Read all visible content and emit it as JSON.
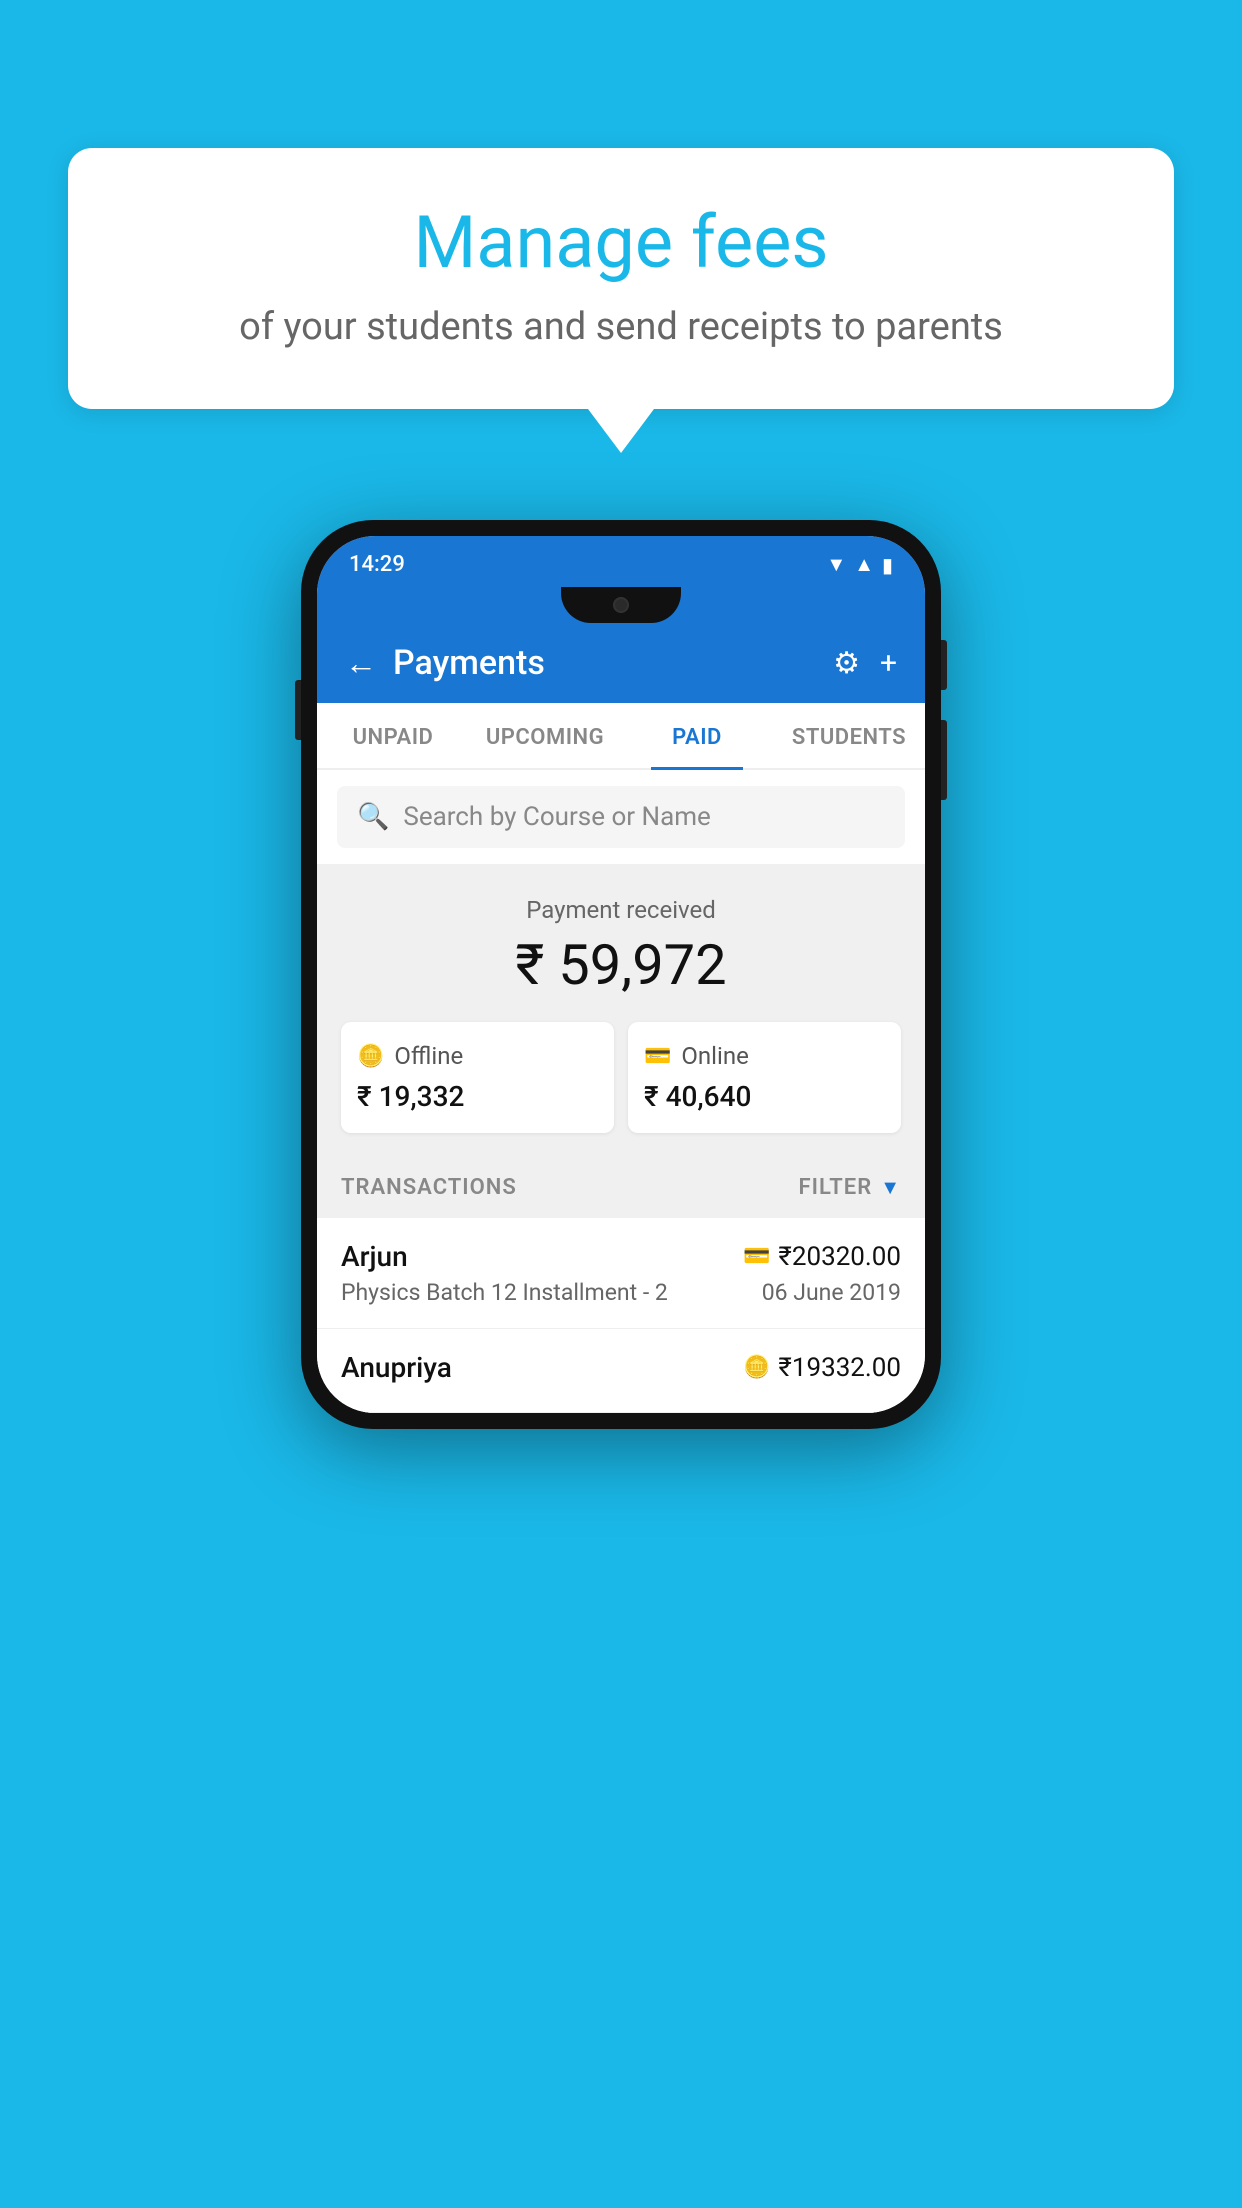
{
  "background_color": "#1ab8e8",
  "bubble": {
    "title": "Manage fees",
    "subtitle": "of your students and send receipts to parents"
  },
  "status_bar": {
    "time": "14:29",
    "icons": [
      "wifi",
      "signal",
      "battery"
    ]
  },
  "app_bar": {
    "title": "Payments",
    "back_label": "←",
    "settings_icon": "⚙",
    "add_icon": "+"
  },
  "tabs": [
    {
      "label": "UNPAID",
      "active": false
    },
    {
      "label": "UPCOMING",
      "active": false
    },
    {
      "label": "PAID",
      "active": true
    },
    {
      "label": "STUDENTS",
      "active": false
    }
  ],
  "search": {
    "placeholder": "Search by Course or Name"
  },
  "payment_summary": {
    "label": "Payment received",
    "total": "₹ 59,972",
    "offline": {
      "type": "Offline",
      "amount": "₹ 19,332"
    },
    "online": {
      "type": "Online",
      "amount": "₹ 40,640"
    }
  },
  "transactions": {
    "header_label": "TRANSACTIONS",
    "filter_label": "FILTER",
    "rows": [
      {
        "name": "Arjun",
        "course": "Physics Batch 12 Installment - 2",
        "amount": "₹20320.00",
        "date": "06 June 2019",
        "icon": "card"
      },
      {
        "name": "Anupriya",
        "amount": "₹19332.00",
        "icon": "cash"
      }
    ]
  }
}
